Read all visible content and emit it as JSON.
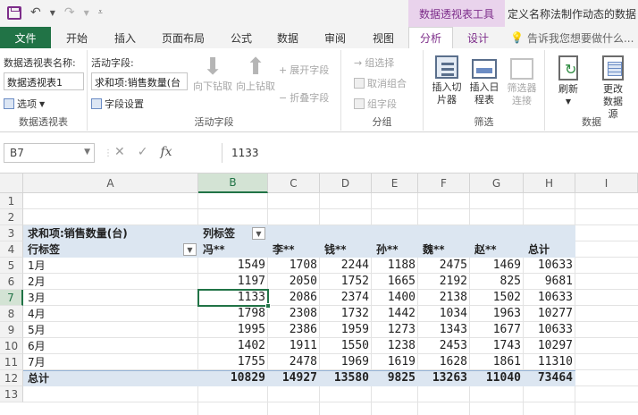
{
  "titlebar": {
    "tool_context": "数据透视表工具",
    "doc_title": "定义名称法制作动态的数据"
  },
  "tabs": [
    "文件",
    "开始",
    "插入",
    "页面布局",
    "公式",
    "数据",
    "审阅",
    "视图",
    "分析",
    "设计"
  ],
  "tell_me": "告诉我您想要做什么...",
  "ribbon": {
    "pivot_name_label": "数据透视表名称:",
    "pivot_name_value": "数据透视表1",
    "options_label": "选项",
    "group_pivot": "数据透视表",
    "active_field_label": "活动字段:",
    "active_field_value": "求和项:销售数量(台",
    "field_settings_label": "字段设置",
    "drill_down": "向下钻取",
    "drill_up": "向上钻取",
    "expand_field": "展开字段",
    "collapse_field": "折叠字段",
    "group_active_field": "活动字段",
    "group_selection": "组选择",
    "ungroup": "取消组合",
    "group_field": "组字段",
    "group_group": "分组",
    "insert_slicer": "插入切片器",
    "insert_timeline": "插入日程表",
    "filter_connections": "筛选器连接",
    "group_filter": "筛选",
    "refresh": "刷新",
    "change_source": "更改数据源",
    "group_data": "数据"
  },
  "formula_bar": {
    "name_box": "B7",
    "formula": "1133"
  },
  "columns": [
    "A",
    "B",
    "C",
    "D",
    "E",
    "F",
    "G",
    "H",
    "I"
  ],
  "rows": [
    "1",
    "2",
    "3",
    "4",
    "5",
    "6",
    "7",
    "8",
    "9",
    "10",
    "11",
    "12",
    "13"
  ],
  "pivot": {
    "value_field": "求和项:销售数量(台)",
    "col_label": "列标签",
    "row_label": "行标签",
    "headers": [
      "冯**",
      "李**",
      "钱**",
      "孙**",
      "魏**",
      "赵**",
      "总计"
    ],
    "body": [
      {
        "label": "1月",
        "values": [
          "1549",
          "1708",
          "2244",
          "1188",
          "2475",
          "1469",
          "10633"
        ]
      },
      {
        "label": "2月",
        "values": [
          "1197",
          "2050",
          "1752",
          "1665",
          "2192",
          "825",
          "9681"
        ]
      },
      {
        "label": "3月",
        "values": [
          "1133",
          "2086",
          "2374",
          "1400",
          "2138",
          "1502",
          "10633"
        ]
      },
      {
        "label": "4月",
        "values": [
          "1798",
          "2308",
          "1732",
          "1442",
          "1034",
          "1963",
          "10277"
        ]
      },
      {
        "label": "5月",
        "values": [
          "1995",
          "2386",
          "1959",
          "1273",
          "1343",
          "1677",
          "10633"
        ]
      },
      {
        "label": "6月",
        "values": [
          "1402",
          "1911",
          "1550",
          "1238",
          "2453",
          "1743",
          "10297"
        ]
      },
      {
        "label": "7月",
        "values": [
          "1755",
          "2478",
          "1969",
          "1619",
          "1628",
          "1861",
          "11310"
        ]
      }
    ],
    "total": {
      "label": "总计",
      "values": [
        "10829",
        "14927",
        "13580",
        "9825",
        "13263",
        "11040",
        "73464"
      ]
    }
  }
}
